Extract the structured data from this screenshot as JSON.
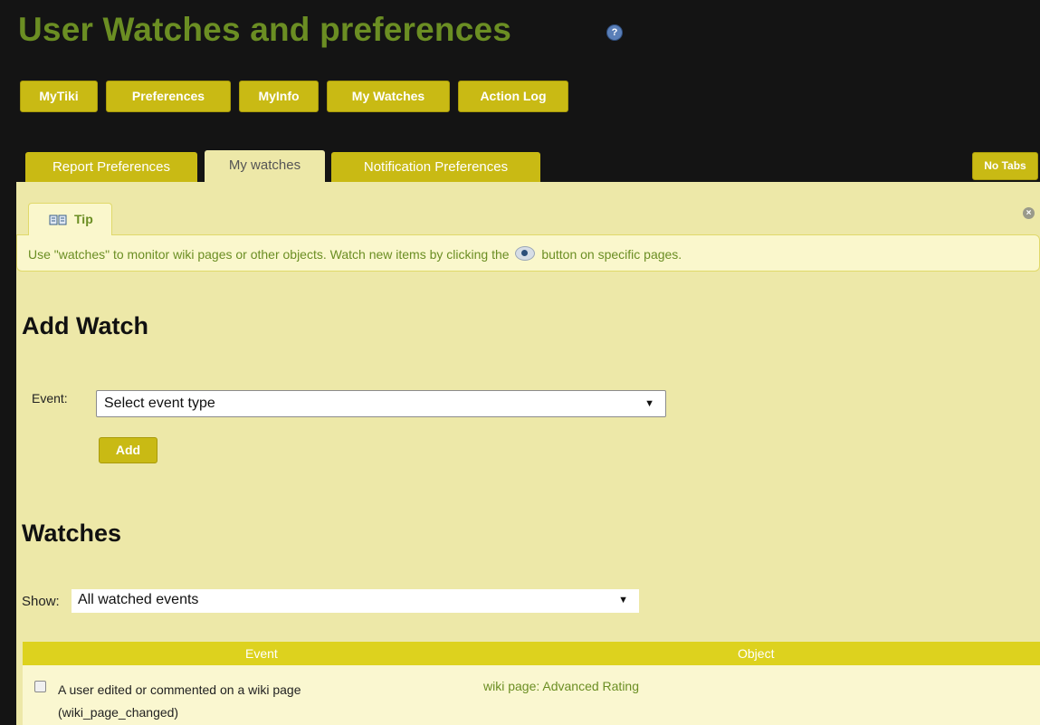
{
  "page": {
    "title": "User Watches and preferences",
    "help_icon": "help-icon"
  },
  "top_nav": [
    {
      "label": "MyTiki"
    },
    {
      "label": "Preferences"
    },
    {
      "label": "MyInfo"
    },
    {
      "label": "My Watches"
    },
    {
      "label": "Action Log"
    }
  ],
  "tabs": [
    {
      "label": "Report Preferences",
      "active": false
    },
    {
      "label": "My watches",
      "active": true
    },
    {
      "label": "Notification Preferences",
      "active": false
    }
  ],
  "no_tabs_label": "No Tabs",
  "tip": {
    "title": "Tip",
    "icon": "book-icon",
    "text_before": "Use \"watches\" to monitor wiki pages or other objects. Watch new items by clicking the",
    "text_after": "button on specific pages.",
    "inline_icon": "eye-icon",
    "close_icon": "close-icon"
  },
  "add_watch": {
    "heading": "Add Watch",
    "event_label": "Event:",
    "event_select_value": "Select event type",
    "add_button": "Add"
  },
  "watches": {
    "heading": "Watches",
    "show_label": "Show:",
    "show_select_value": "All watched events",
    "columns": [
      "Event",
      "Object"
    ],
    "rows": [
      {
        "event_line1": "A user edited or commented on a wiki page",
        "event_line2": "(wiki_page_changed)",
        "object": "wiki page: Advanced Rating",
        "checked": false
      }
    ]
  },
  "colors": {
    "accent": "#c9ba14",
    "title_green": "#6b8e23",
    "panel_bg": "#ede8a8",
    "table_header": "#ddd21e"
  }
}
